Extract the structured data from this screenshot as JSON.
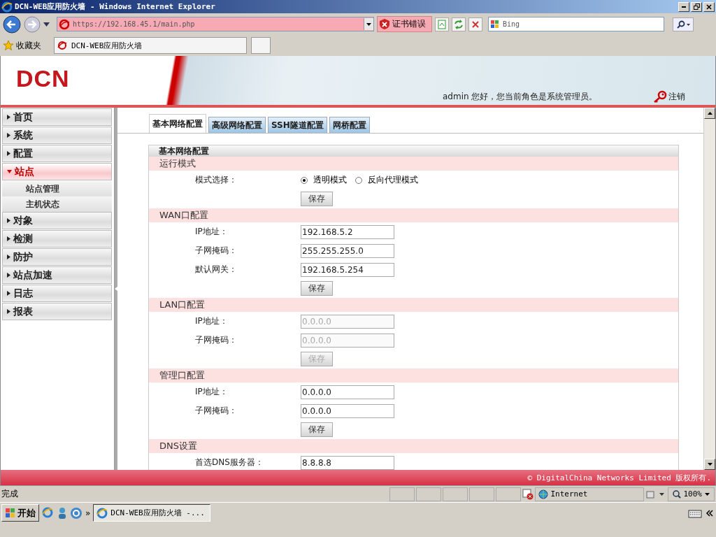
{
  "window": {
    "title": "DCN-WEB应用防火墙 - Windows Internet Explorer"
  },
  "toolbar": {
    "address": "https://192.168.45.1/main.php",
    "cert_error": "证书错误",
    "search_placeholder": "Bing"
  },
  "favorites": {
    "label": "收藏夹",
    "tabs": [
      {
        "label": "DCN-WEB应用防火墙",
        "selected": true
      }
    ]
  },
  "header": {
    "logo": "DCN",
    "greeting": "admin 您好，您当前角色是系统管理员。",
    "logout": "注销"
  },
  "sidebar": {
    "items": [
      {
        "label": "首页",
        "expanded": false
      },
      {
        "label": "系统",
        "expanded": false
      },
      {
        "label": "配置",
        "expanded": false
      },
      {
        "label": "站点",
        "expanded": true,
        "children": [
          {
            "label": "站点管理"
          },
          {
            "label": "主机状态"
          }
        ]
      },
      {
        "label": "对象",
        "expanded": false
      },
      {
        "label": "检测",
        "expanded": false
      },
      {
        "label": "防护",
        "expanded": false
      },
      {
        "label": "站点加速",
        "expanded": false
      },
      {
        "label": "日志",
        "expanded": false
      },
      {
        "label": "报表",
        "expanded": false
      }
    ]
  },
  "tabs": [
    {
      "label": "基本网络配置",
      "selected": true
    },
    {
      "label": "高级网络配置",
      "selected": false
    },
    {
      "label": "SSH隧道配置",
      "selected": false
    },
    {
      "label": "网桥配置",
      "selected": false
    }
  ],
  "panel": {
    "title": "基本网络配置",
    "sections": [
      {
        "title": "运行模式",
        "rows": [
          {
            "kind": "radio",
            "label": "模式选择：",
            "options": [
              {
                "label": "透明模式",
                "selected": true
              },
              {
                "label": "反向代理模式",
                "selected": false
              }
            ]
          }
        ],
        "save": {
          "label": "保存",
          "disabled": false
        }
      },
      {
        "title": "WAN口配置",
        "rows": [
          {
            "kind": "field",
            "label": "IP地址：",
            "value": "192.168.5.2",
            "disabled": false
          },
          {
            "kind": "field",
            "label": "子网掩码：",
            "value": "255.255.255.0",
            "disabled": false
          },
          {
            "kind": "field",
            "label": "默认网关：",
            "value": "192.168.5.254",
            "disabled": false
          }
        ],
        "save": {
          "label": "保存",
          "disabled": false
        }
      },
      {
        "title": "LAN口配置",
        "rows": [
          {
            "kind": "field",
            "label": "IP地址：",
            "value": "0.0.0.0",
            "disabled": true
          },
          {
            "kind": "field",
            "label": "子网掩码：",
            "value": "0.0.0.0",
            "disabled": true
          }
        ],
        "save": {
          "label": "保存",
          "disabled": true
        }
      },
      {
        "title": "管理口配置",
        "rows": [
          {
            "kind": "field",
            "label": "IP地址：",
            "value": "0.0.0.0",
            "disabled": false
          },
          {
            "kind": "field",
            "label": "子网掩码：",
            "value": "0.0.0.0",
            "disabled": false
          }
        ],
        "save": {
          "label": "保存",
          "disabled": false
        }
      },
      {
        "title": "DNS设置",
        "rows": [
          {
            "kind": "field",
            "label": "首选DNS服务器：",
            "value": "8.8.8.8",
            "disabled": false
          }
        ]
      }
    ]
  },
  "footer": {
    "copyright": "© DigitalChina Networks Limited 版权所有."
  },
  "status_bar": {
    "text": "完成",
    "zone": "Internet",
    "zoom": "100%"
  },
  "taskbar": {
    "start": "开始",
    "more": "»",
    "tasks": [
      {
        "label": "DCN-WEB应用防火墙 -...",
        "selected": true
      }
    ]
  }
}
